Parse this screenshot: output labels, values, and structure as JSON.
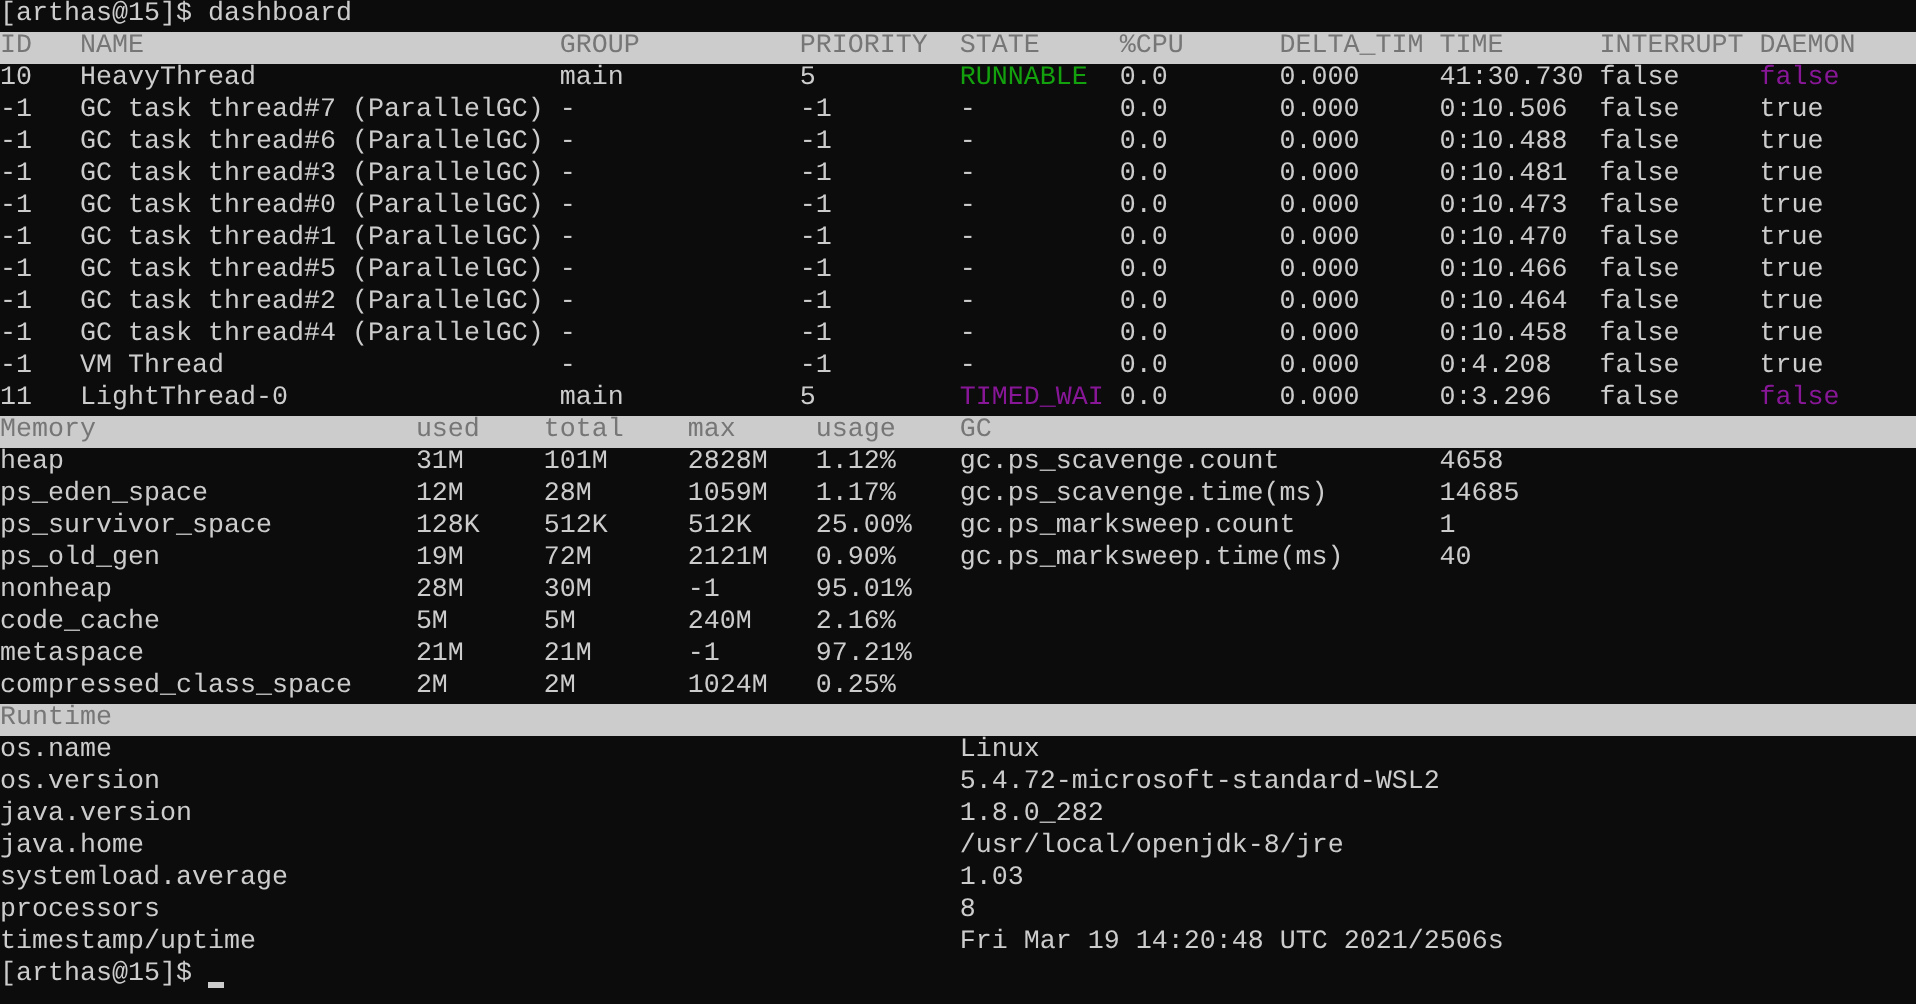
{
  "command_line": "[arthas@15]$ dashboard",
  "threads": {
    "columns": [
      "ID",
      "NAME",
      "GROUP",
      "PRIORITY",
      "STATE",
      "%CPU",
      "DELTA_TIM",
      "TIME",
      "INTERRUPT",
      "DAEMON"
    ],
    "rows": [
      {
        "id": "10",
        "name": "HeavyThread",
        "group": "main",
        "priority": "5",
        "state": {
          "text": "RUNNABLE",
          "color": "#13a10e"
        },
        "cpu": "0.0",
        "delta_time": "0.000",
        "time": "41:30.730",
        "interrupt": "false",
        "daemon": {
          "text": "false",
          "color": "#881798"
        }
      },
      {
        "id": "-1",
        "name": "GC task thread#7 (ParallelGC)",
        "group": "-",
        "priority": "-1",
        "state": {
          "text": "-",
          "color": "#cccccc"
        },
        "cpu": "0.0",
        "delta_time": "0.000",
        "time": "0:10.506",
        "interrupt": "false",
        "daemon": {
          "text": "true",
          "color": "#cccccc"
        }
      },
      {
        "id": "-1",
        "name": "GC task thread#6 (ParallelGC)",
        "group": "-",
        "priority": "-1",
        "state": {
          "text": "-",
          "color": "#cccccc"
        },
        "cpu": "0.0",
        "delta_time": "0.000",
        "time": "0:10.488",
        "interrupt": "false",
        "daemon": {
          "text": "true",
          "color": "#cccccc"
        }
      },
      {
        "id": "-1",
        "name": "GC task thread#3 (ParallelGC)",
        "group": "-",
        "priority": "-1",
        "state": {
          "text": "-",
          "color": "#cccccc"
        },
        "cpu": "0.0",
        "delta_time": "0.000",
        "time": "0:10.481",
        "interrupt": "false",
        "daemon": {
          "text": "true",
          "color": "#cccccc"
        }
      },
      {
        "id": "-1",
        "name": "GC task thread#0 (ParallelGC)",
        "group": "-",
        "priority": "-1",
        "state": {
          "text": "-",
          "color": "#cccccc"
        },
        "cpu": "0.0",
        "delta_time": "0.000",
        "time": "0:10.473",
        "interrupt": "false",
        "daemon": {
          "text": "true",
          "color": "#cccccc"
        }
      },
      {
        "id": "-1",
        "name": "GC task thread#1 (ParallelGC)",
        "group": "-",
        "priority": "-1",
        "state": {
          "text": "-",
          "color": "#cccccc"
        },
        "cpu": "0.0",
        "delta_time": "0.000",
        "time": "0:10.470",
        "interrupt": "false",
        "daemon": {
          "text": "true",
          "color": "#cccccc"
        }
      },
      {
        "id": "-1",
        "name": "GC task thread#5 (ParallelGC)",
        "group": "-",
        "priority": "-1",
        "state": {
          "text": "-",
          "color": "#cccccc"
        },
        "cpu": "0.0",
        "delta_time": "0.000",
        "time": "0:10.466",
        "interrupt": "false",
        "daemon": {
          "text": "true",
          "color": "#cccccc"
        }
      },
      {
        "id": "-1",
        "name": "GC task thread#2 (ParallelGC)",
        "group": "-",
        "priority": "-1",
        "state": {
          "text": "-",
          "color": "#cccccc"
        },
        "cpu": "0.0",
        "delta_time": "0.000",
        "time": "0:10.464",
        "interrupt": "false",
        "daemon": {
          "text": "true",
          "color": "#cccccc"
        }
      },
      {
        "id": "-1",
        "name": "GC task thread#4 (ParallelGC)",
        "group": "-",
        "priority": "-1",
        "state": {
          "text": "-",
          "color": "#cccccc"
        },
        "cpu": "0.0",
        "delta_time": "0.000",
        "time": "0:10.458",
        "interrupt": "false",
        "daemon": {
          "text": "true",
          "color": "#cccccc"
        }
      },
      {
        "id": "-1",
        "name": "VM Thread",
        "group": "-",
        "priority": "-1",
        "state": {
          "text": "-",
          "color": "#cccccc"
        },
        "cpu": "0.0",
        "delta_time": "0.000",
        "time": "0:4.208",
        "interrupt": "false",
        "daemon": {
          "text": "true",
          "color": "#cccccc"
        }
      },
      {
        "id": "11",
        "name": "LightThread-0",
        "group": "main",
        "priority": "5",
        "state": {
          "text": "TIMED_WAI",
          "color": "#881798"
        },
        "cpu": "0.0",
        "delta_time": "0.000",
        "time": "0:3.296",
        "interrupt": "false",
        "daemon": {
          "text": "false",
          "color": "#881798"
        }
      }
    ]
  },
  "memory": {
    "columns": [
      "Memory",
      "used",
      "total",
      "max",
      "usage"
    ],
    "rows": [
      [
        "heap",
        "31M",
        "101M",
        "2828M",
        "1.12%"
      ],
      [
        "ps_eden_space",
        "12M",
        "28M",
        "1059M",
        "1.17%"
      ],
      [
        "ps_survivor_space",
        "128K",
        "512K",
        "512K",
        "25.00%"
      ],
      [
        "ps_old_gen",
        "19M",
        "72M",
        "2121M",
        "0.90%"
      ],
      [
        "nonheap",
        "28M",
        "30M",
        "-1",
        "95.01%"
      ],
      [
        "code_cache",
        "5M",
        "5M",
        "240M",
        "2.16%"
      ],
      [
        "metaspace",
        "21M",
        "21M",
        "-1",
        "97.21%"
      ],
      [
        "compressed_class_space",
        "2M",
        "2M",
        "1024M",
        "0.25%"
      ]
    ]
  },
  "gc": {
    "title": "GC",
    "rows": [
      {
        "name": "gc.ps_scavenge.count",
        "value": "4658"
      },
      {
        "name": "gc.ps_scavenge.time(ms)",
        "value": "14685"
      },
      {
        "name": "gc.ps_marksweep.count",
        "value": "1"
      },
      {
        "name": "gc.ps_marksweep.time(ms)",
        "value": "40"
      }
    ]
  },
  "runtime": {
    "title": "Runtime",
    "rows": [
      {
        "name": "os.name",
        "value": "Linux"
      },
      {
        "name": "os.version",
        "value": "5.4.72-microsoft-standard-WSL2"
      },
      {
        "name": "java.version",
        "value": "1.8.0_282"
      },
      {
        "name": "java.home",
        "value": "/usr/local/openjdk-8/jre"
      },
      {
        "name": "systemload.average",
        "value": "1.03"
      },
      {
        "name": "processors",
        "value": "8"
      },
      {
        "name": "timestamp/uptime",
        "value": "Fri Mar 19 14:20:48 UTC 2021/2506s"
      }
    ]
  },
  "prompt": "[arthas@15]$"
}
